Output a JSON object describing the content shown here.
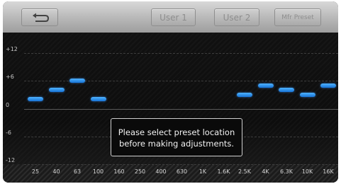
{
  "toolbar": {
    "back_icon": "back-arrow-icon",
    "user1_label": "User 1",
    "user2_label": "User 2",
    "mfr_label": "Mfr Preset"
  },
  "popup": {
    "line1": "Please select preset location",
    "line2": "before making adjustments."
  },
  "chart_data": {
    "type": "scatter",
    "categories": [
      "25",
      "40",
      "63",
      "100",
      "160",
      "250",
      "400",
      "630",
      "1K",
      "1.6K",
      "2.5K",
      "4K",
      "6.3K",
      "10K",
      "16K"
    ],
    "y_ticks": [
      "+12",
      "+6",
      "0",
      "-6",
      "-12"
    ],
    "ylim": [
      -12,
      12
    ],
    "series": [
      {
        "values": [
          2,
          4,
          6,
          2,
          null,
          null,
          null,
          null,
          null,
          null,
          3,
          5,
          4,
          3,
          5
        ]
      }
    ],
    "colors": {
      "bar": "#2e8ff0"
    }
  }
}
